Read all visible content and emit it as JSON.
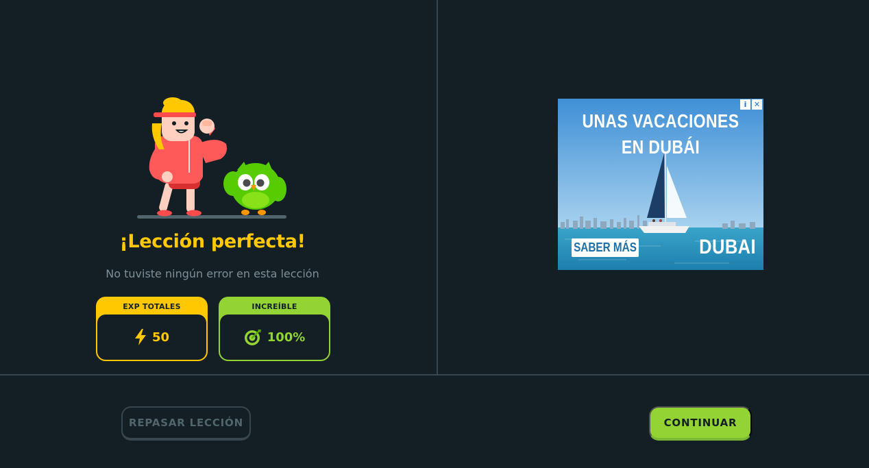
{
  "result": {
    "title": "¡Lección perfecta!",
    "subtitle": "No tuviste ningún error en esta lección"
  },
  "stats": [
    {
      "label": "EXP TOTALES",
      "value": "50",
      "icon": "lightning-bolt-icon",
      "color": "#ffc800"
    },
    {
      "label": "INCREÍBLE",
      "value": "100%",
      "icon": "target-icon",
      "color": "#93d333"
    }
  ],
  "ad": {
    "headline_line1": "UNAS VACACIONES",
    "headline_line2": "EN DUBÁI",
    "cta": "SABER MÁS",
    "brand": "DUBAI",
    "info_icon": "i",
    "close_icon": "✕"
  },
  "footer": {
    "review_label": "REPASAR LECCIÓN",
    "continue_label": "CONTINUAR"
  },
  "colors": {
    "background": "#131f24",
    "gold": "#ffc800",
    "green": "#93d333",
    "muted": "#7e8f99",
    "border": "#37464f"
  }
}
